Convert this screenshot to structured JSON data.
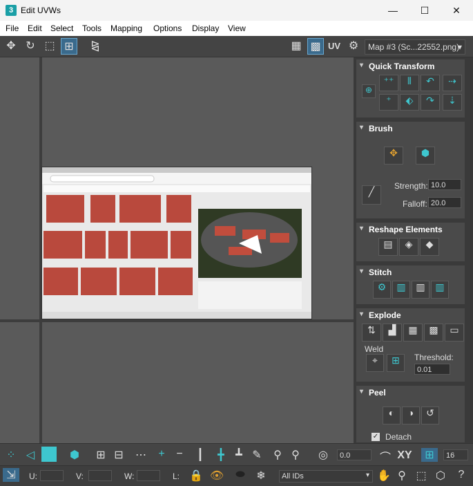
{
  "window": {
    "title": "Edit UVWs",
    "app_icon": "3",
    "minimize": "—",
    "maximize": "☐",
    "close": "✕"
  },
  "menu": [
    "File",
    "Edit",
    "Select",
    "Tools",
    "Mapping",
    "Options",
    "Display",
    "View"
  ],
  "toolbar": {
    "uv_label": "UV",
    "map_select": "Map #3 (Sc...22552.png)"
  },
  "panel": {
    "quick_transform": {
      "title": "Quick Transform"
    },
    "brush": {
      "title": "Brush",
      "strength_label": "Strength:",
      "strength_value": "10.0",
      "falloff_label": "Falloff:",
      "falloff_value": "20.0"
    },
    "reshape": {
      "title": "Reshape Elements"
    },
    "stitch": {
      "title": "Stitch"
    },
    "explode": {
      "title": "Explode",
      "weld_label": "Weld",
      "threshold_label": "Threshold:",
      "threshold_value": "0.01"
    },
    "peel": {
      "title": "Peel",
      "detach_label": "Detach",
      "detach_checked": true
    }
  },
  "bottom": {
    "coord_value": "0.0",
    "xy_label": "XY",
    "grid_value": "16",
    "u_label": "U:",
    "v_label": "V:",
    "w_label": "W:",
    "l_label": "L:",
    "ids_select": "All IDs"
  }
}
